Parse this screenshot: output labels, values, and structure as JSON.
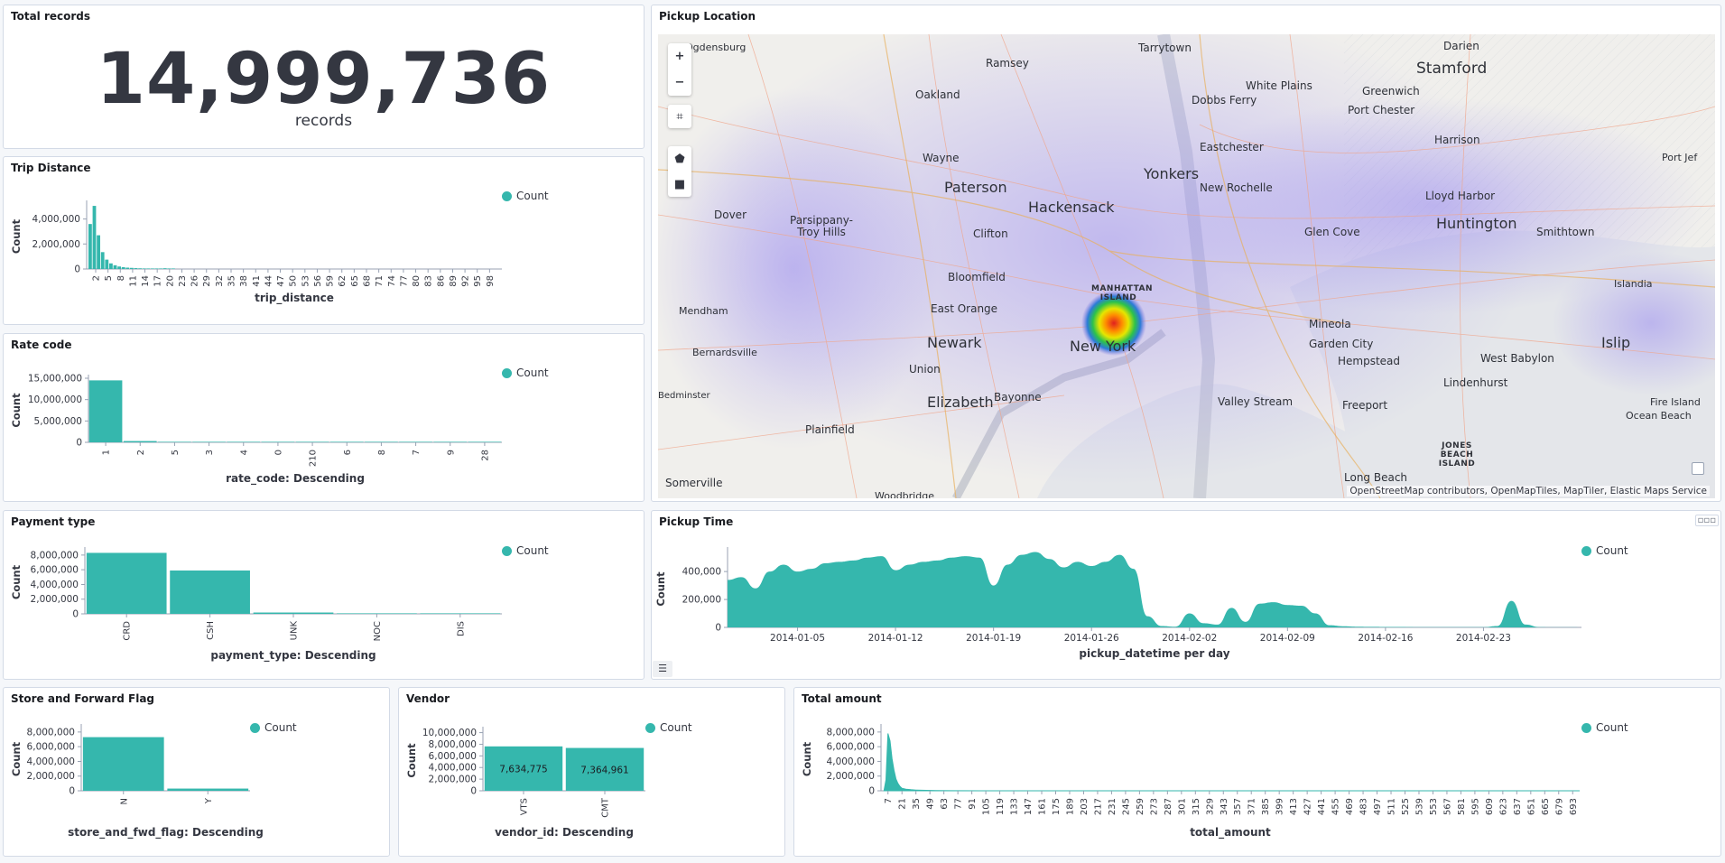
{
  "colors": {
    "series": "#35b7ad",
    "text": "#343741",
    "axis": "#98a2b3",
    "grid": "#eef0f3"
  },
  "total_records": {
    "title": "Total records",
    "value": "14,999,736",
    "label": "records"
  },
  "trip_distance": {
    "title": "Trip Distance",
    "ylabel": "Count",
    "xlabel": "trip_distance",
    "legend": "Count",
    "yticks": [
      "4,000,000",
      "2,000,000",
      "0"
    ],
    "xticks": [
      "2",
      "5",
      "8",
      "11",
      "14",
      "17",
      "20",
      "23",
      "26",
      "29",
      "32",
      "35",
      "38",
      "41",
      "44",
      "47",
      "50",
      "53",
      "56",
      "59",
      "62",
      "65",
      "68",
      "71",
      "74",
      "77",
      "80",
      "83",
      "86",
      "89",
      "92",
      "95",
      "98"
    ]
  },
  "rate_code": {
    "title": "Rate code",
    "ylabel": "Count",
    "xlabel": "rate_code: Descending",
    "legend": "Count",
    "yticks": [
      "15,000,000",
      "10,000,000",
      "5,000,000",
      "0"
    ],
    "xticks": [
      "1",
      "2",
      "5",
      "3",
      "4",
      "0",
      "210",
      "6",
      "8",
      "7",
      "9",
      "28"
    ]
  },
  "payment_type": {
    "title": "Payment type",
    "ylabel": "Count",
    "xlabel": "payment_type: Descending",
    "legend": "Count",
    "yticks": [
      "8,000,000",
      "6,000,000",
      "4,000,000",
      "2,000,000",
      "0"
    ],
    "xticks": [
      "CRD",
      "CSH",
      "UNK",
      "NOC",
      "DIS"
    ]
  },
  "store_fwd": {
    "title": "Store and Forward Flag",
    "ylabel": "Count",
    "xlabel": "store_and_fwd_flag: Descending",
    "legend": "Count",
    "yticks": [
      "8,000,000",
      "6,000,000",
      "4,000,000",
      "2,000,000",
      "0"
    ],
    "xticks": [
      "N",
      "Y"
    ]
  },
  "vendor": {
    "title": "Vendor",
    "ylabel": "Count",
    "xlabel": "vendor_id: Descending",
    "legend": "Count",
    "yticks": [
      "10,000,000",
      "8,000,000",
      "6,000,000",
      "4,000,000",
      "2,000,000",
      "0"
    ],
    "xticks": [
      "VTS",
      "CMT"
    ],
    "data_labels": [
      "7,634,775",
      "7,364,961"
    ]
  },
  "total_amount": {
    "title": "Total amount",
    "ylabel": "Count",
    "xlabel": "total_amount",
    "legend": "Count",
    "yticks": [
      "8,000,000",
      "6,000,000",
      "4,000,000",
      "2,000,000",
      "0"
    ],
    "xticks": [
      "7",
      "21",
      "35",
      "49",
      "63",
      "77",
      "91",
      "105",
      "119",
      "133",
      "147",
      "161",
      "175",
      "189",
      "203",
      "217",
      "231",
      "245",
      "259",
      "273",
      "287",
      "301",
      "315",
      "329",
      "343",
      "357",
      "371",
      "385",
      "399",
      "413",
      "427",
      "441",
      "455",
      "469",
      "483",
      "497",
      "511",
      "525",
      "539",
      "553",
      "567",
      "581",
      "595",
      "609",
      "623",
      "637",
      "651",
      "665",
      "679",
      "693"
    ]
  },
  "pickup_time": {
    "title": "Pickup Time",
    "ylabel": "Count",
    "xlabel": "pickup_datetime per day",
    "legend": "Count",
    "yticks": [
      "400,000",
      "200,000",
      "0"
    ],
    "xticks": [
      "2014-01-05",
      "2014-01-12",
      "2014-01-19",
      "2014-01-26",
      "2014-02-02",
      "2014-02-09",
      "2014-02-16",
      "2014-02-23"
    ]
  },
  "map": {
    "title": "Pickup Location",
    "attribution": "OpenStreetMap contributors, OpenMapTiles, MapTiler, Elastic Maps Service",
    "controls": [
      "+",
      "−",
      "⌗",
      "⬟",
      "■"
    ],
    "labels": [
      "Ogdensburg",
      "Tarrytown",
      "Darien",
      "Stamford",
      "Ramsey",
      "Oakland",
      "White Plains",
      "Greenwich",
      "Dobbs Ferry",
      "Port Chester",
      "Wayne",
      "Harrison",
      "Eastchester",
      "Port Jef",
      "Yonkers",
      "Paterson",
      "Hackensack",
      "New Rochelle",
      "Lloyd Harbor",
      "Dover",
      "Parsippany-Troy Hills",
      "Clifton",
      "Glen Cove",
      "Huntington",
      "Smithtown",
      "Bloomfield",
      "MANHATTAN ISLAND",
      "Mendham",
      "East Orange",
      "Islandia",
      "Newark",
      "New York",
      "Mineola",
      "Garden City",
      "Hempstead",
      "Bernardsville",
      "Union",
      "West Babylon",
      "Islip",
      "Elizabeth",
      "Bayonne",
      "Lindenhurst",
      "Valley Stream",
      "Freeport",
      "Fire Island",
      "Ocean Beach",
      "Plainfield",
      "JONES BEACH ISLAND",
      "Long Beach",
      "Somerville",
      "Bedminster",
      "Woodbridge"
    ]
  },
  "chart_data": [
    {
      "type": "bar",
      "title": "Trip Distance",
      "xlabel": "trip_distance",
      "ylabel": "Count",
      "ylim": [
        0,
        5200000
      ],
      "x": [
        0,
        1,
        2,
        3,
        4,
        5,
        6,
        7,
        8,
        9,
        10,
        11,
        12,
        13,
        14,
        15,
        16,
        17,
        18,
        19,
        20
      ],
      "series": [
        {
          "name": "Count",
          "values": [
            3600000,
            5050000,
            2700000,
            1350000,
            750000,
            450000,
            300000,
            200000,
            150000,
            110000,
            90000,
            70000,
            55000,
            45000,
            35000,
            30000,
            25000,
            20000,
            60000,
            20000,
            10000
          ]
        }
      ]
    },
    {
      "type": "bar",
      "title": "Rate code",
      "xlabel": "rate_code: Descending",
      "ylabel": "Count",
      "ylim": [
        0,
        15000000
      ],
      "categories": [
        "1",
        "2",
        "5",
        "3",
        "4",
        "0",
        "210",
        "6",
        "8",
        "7",
        "9",
        "28"
      ],
      "series": [
        {
          "name": "Count",
          "values": [
            14500000,
            300000,
            60000,
            30000,
            10000,
            2000,
            100,
            100,
            50,
            30,
            10,
            5
          ]
        }
      ]
    },
    {
      "type": "bar",
      "title": "Payment type",
      "xlabel": "payment_type: Descending",
      "ylabel": "Count",
      "ylim": [
        0,
        8600000
      ],
      "categories": [
        "CRD",
        "CSH",
        "UNK",
        "NOC",
        "DIS"
      ],
      "series": [
        {
          "name": "Count",
          "values": [
            8300000,
            5900000,
            180000,
            60000,
            15000
          ]
        }
      ]
    },
    {
      "type": "bar",
      "title": "Store and Forward Flag",
      "xlabel": "store_and_fwd_flag: Descending",
      "ylabel": "Count",
      "ylim": [
        0,
        8600000
      ],
      "categories": [
        "N",
        "Y"
      ],
      "series": [
        {
          "name": "Count",
          "values": [
            7300000,
            300000
          ]
        }
      ]
    },
    {
      "type": "bar",
      "title": "Vendor",
      "xlabel": "vendor_id: Descending",
      "ylabel": "Count",
      "ylim": [
        0,
        10400000
      ],
      "categories": [
        "VTS",
        "CMT"
      ],
      "series": [
        {
          "name": "Count",
          "values": [
            7634775,
            7364961
          ]
        }
      ]
    },
    {
      "type": "area",
      "title": "Total amount",
      "xlabel": "total_amount",
      "ylabel": "Count",
      "ylim": [
        0,
        8600000
      ],
      "x": [
        3,
        5,
        7,
        9,
        11,
        13,
        15,
        17,
        19,
        21,
        25,
        30,
        35,
        45,
        55,
        70,
        100,
        200,
        700
      ],
      "series": [
        {
          "name": "Count",
          "values": [
            0,
            1500000,
            7800000,
            6800000,
            4400000,
            2800000,
            1600000,
            1000000,
            600000,
            350000,
            220000,
            150000,
            100000,
            60000,
            30000,
            15000,
            5000,
            1000,
            0
          ]
        }
      ]
    },
    {
      "type": "area",
      "title": "Pickup Time",
      "xlabel": "pickup_datetime per day",
      "ylabel": "Count",
      "ylim": [
        0,
        550000
      ],
      "x": [
        "2013-12-31",
        "2014-01-01",
        "2014-01-02",
        "2014-01-03",
        "2014-01-04",
        "2014-01-05",
        "2014-01-06",
        "2014-01-07",
        "2014-01-08",
        "2014-01-09",
        "2014-01-10",
        "2014-01-11",
        "2014-01-12",
        "2014-01-13",
        "2014-01-14",
        "2014-01-15",
        "2014-01-16",
        "2014-01-17",
        "2014-01-18",
        "2014-01-19",
        "2014-01-20",
        "2014-01-21",
        "2014-01-22",
        "2014-01-23",
        "2014-01-24",
        "2014-01-25",
        "2014-01-26",
        "2014-01-27",
        "2014-01-28",
        "2014-01-29",
        "2014-01-30",
        "2014-01-31",
        "2014-02-01",
        "2014-02-02",
        "2014-02-03",
        "2014-02-04",
        "2014-02-05",
        "2014-02-06",
        "2014-02-07",
        "2014-02-08",
        "2014-02-09",
        "2014-02-10",
        "2014-02-11",
        "2014-02-12",
        "2014-02-13",
        "2014-02-14",
        "2014-02-15",
        "2014-02-16",
        "2014-02-17",
        "2014-02-18",
        "2014-02-19",
        "2014-02-20",
        "2014-02-21",
        "2014-02-22",
        "2014-02-23",
        "2014-02-24",
        "2014-02-25",
        "2014-02-26",
        "2014-02-27",
        "2014-02-28",
        "2014-03-01",
        "2014-03-02"
      ],
      "series": [
        {
          "name": "Count",
          "values": [
            340000,
            360000,
            280000,
            400000,
            450000,
            400000,
            420000,
            460000,
            470000,
            480000,
            500000,
            510000,
            410000,
            450000,
            470000,
            480000,
            500000,
            510000,
            500000,
            300000,
            450000,
            520000,
            540000,
            490000,
            430000,
            470000,
            440000,
            470000,
            520000,
            420000,
            80000,
            10000,
            5000,
            100000,
            30000,
            20000,
            140000,
            40000,
            170000,
            180000,
            160000,
            155000,
            100000,
            15000,
            8000,
            5000,
            4000,
            3000,
            3000,
            2000,
            2000,
            2000,
            2000,
            2000,
            2000,
            10000,
            190000,
            20000,
            2000,
            1000,
            500,
            0
          ]
        }
      ]
    }
  ]
}
